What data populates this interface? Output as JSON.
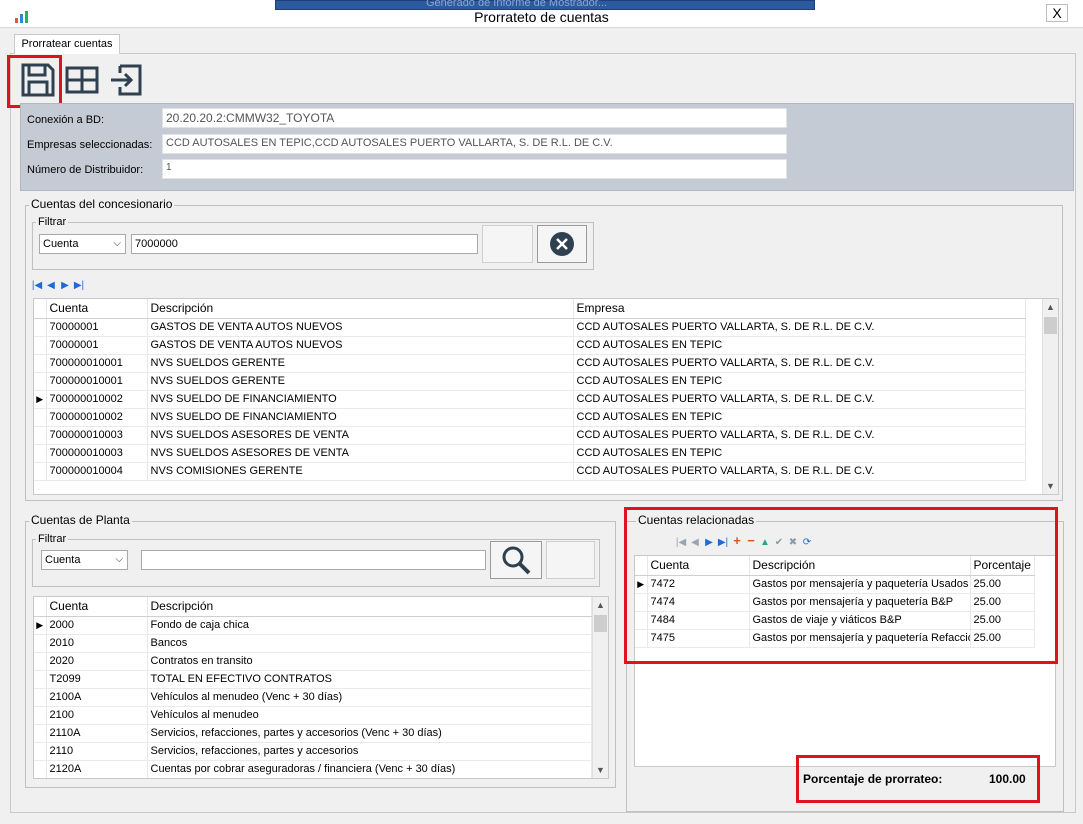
{
  "window": {
    "title": "Prorrateto de cuentas",
    "taskbar_text": "Generado de Informe de Mostrador...",
    "close_label": "X"
  },
  "tab": {
    "label": "Prorratear cuentas"
  },
  "toolbar": {
    "save_icon": "save-icon",
    "grid_icon": "grid-icon",
    "exit_icon": "exit-icon"
  },
  "info": {
    "conexion_label": "Conexión a BD:",
    "conexion_value": "20.20.20.2:CMMW32_TOYOTA",
    "empresas_label": "Empresas seleccionadas:",
    "empresas_value": "CCD AUTOSALES EN TEPIC,CCD AUTOSALES PUERTO VALLARTA, S. DE R.L. DE C.V.",
    "distribuidor_label": "Número de Distribuidor:",
    "distribuidor_value": "1"
  },
  "concesionario": {
    "title": "Cuentas del concesionario",
    "filter_label": "Filtrar",
    "filter_select": "Cuenta",
    "filter_value": "7000000",
    "columns": [
      "Cuenta",
      "Descripción",
      "Empresa"
    ],
    "current_row": 4,
    "rows": [
      [
        "70000001",
        "GASTOS DE VENTA AUTOS NUEVOS",
        "CCD AUTOSALES PUERTO VALLARTA, S. DE R.L. DE C.V."
      ],
      [
        "70000001",
        "GASTOS DE VENTA AUTOS NUEVOS",
        "CCD AUTOSALES EN TEPIC"
      ],
      [
        "700000010001",
        "NVS SUELDOS GERENTE",
        "CCD AUTOSALES PUERTO VALLARTA, S. DE R.L. DE C.V."
      ],
      [
        "700000010001",
        "NVS SUELDOS GERENTE",
        "CCD AUTOSALES EN TEPIC"
      ],
      [
        "700000010002",
        "NVS SUELDO DE FINANCIAMIENTO",
        "CCD AUTOSALES PUERTO VALLARTA, S. DE R.L. DE C.V."
      ],
      [
        "700000010002",
        "NVS SUELDO DE FINANCIAMIENTO",
        "CCD AUTOSALES EN TEPIC"
      ],
      [
        "700000010003",
        "NVS SUELDOS ASESORES DE VENTA",
        "CCD AUTOSALES PUERTO VALLARTA, S. DE R.L. DE C.V."
      ],
      [
        "700000010003",
        "NVS SUELDOS ASESORES DE VENTA",
        "CCD AUTOSALES EN TEPIC"
      ],
      [
        "700000010004",
        "NVS COMISIONES GERENTE",
        "CCD AUTOSALES PUERTO VALLARTA, S. DE R.L. DE C.V."
      ]
    ]
  },
  "planta": {
    "title": "Cuentas de Planta",
    "filter_label": "Filtrar",
    "filter_select": "Cuenta",
    "filter_value": "",
    "columns": [
      "Cuenta",
      "Descripción"
    ],
    "current_row": 0,
    "rows": [
      [
        "2000",
        "Fondo de caja chica"
      ],
      [
        "2010",
        "Bancos"
      ],
      [
        "2020",
        "Contratos en transito"
      ],
      [
        "T2099",
        "TOTAL EN EFECTIVO CONTRATOS"
      ],
      [
        "2100A",
        "Vehículos al menudeo (Venc + 30 días)"
      ],
      [
        "2100",
        "Vehículos al menudeo"
      ],
      [
        "2110A",
        "Servicios, refacciones, partes y accesorios  (Venc + 30 días)"
      ],
      [
        "2110",
        "Servicios, refacciones, partes y accesorios"
      ],
      [
        "2120A",
        "Cuentas por cobrar aseguradoras / financiera (Venc + 30 días)"
      ]
    ]
  },
  "relacionadas": {
    "title": "Cuentas relacionadas",
    "columns": [
      "Cuenta",
      "Descripción",
      "Porcentaje"
    ],
    "current_row": 0,
    "rows": [
      [
        "7472",
        "Gastos por mensajería y paquetería  Usados y",
        "25.00"
      ],
      [
        "7474",
        "Gastos por mensajería y paquetería  B&P",
        "25.00"
      ],
      [
        "7484",
        "Gastos de viaje y viáticos B&P",
        "25.00"
      ],
      [
        "7475",
        "Gastos por mensajería y paquetería  Refaccion",
        "25.00"
      ]
    ],
    "percent_label": "Porcentaje de prorrateo:",
    "percent_value": "100.00"
  },
  "colors": {
    "highlight_red": "#e0121b",
    "info_panel": "#c4cbd4",
    "nav_blue": "#1e6ad8"
  }
}
